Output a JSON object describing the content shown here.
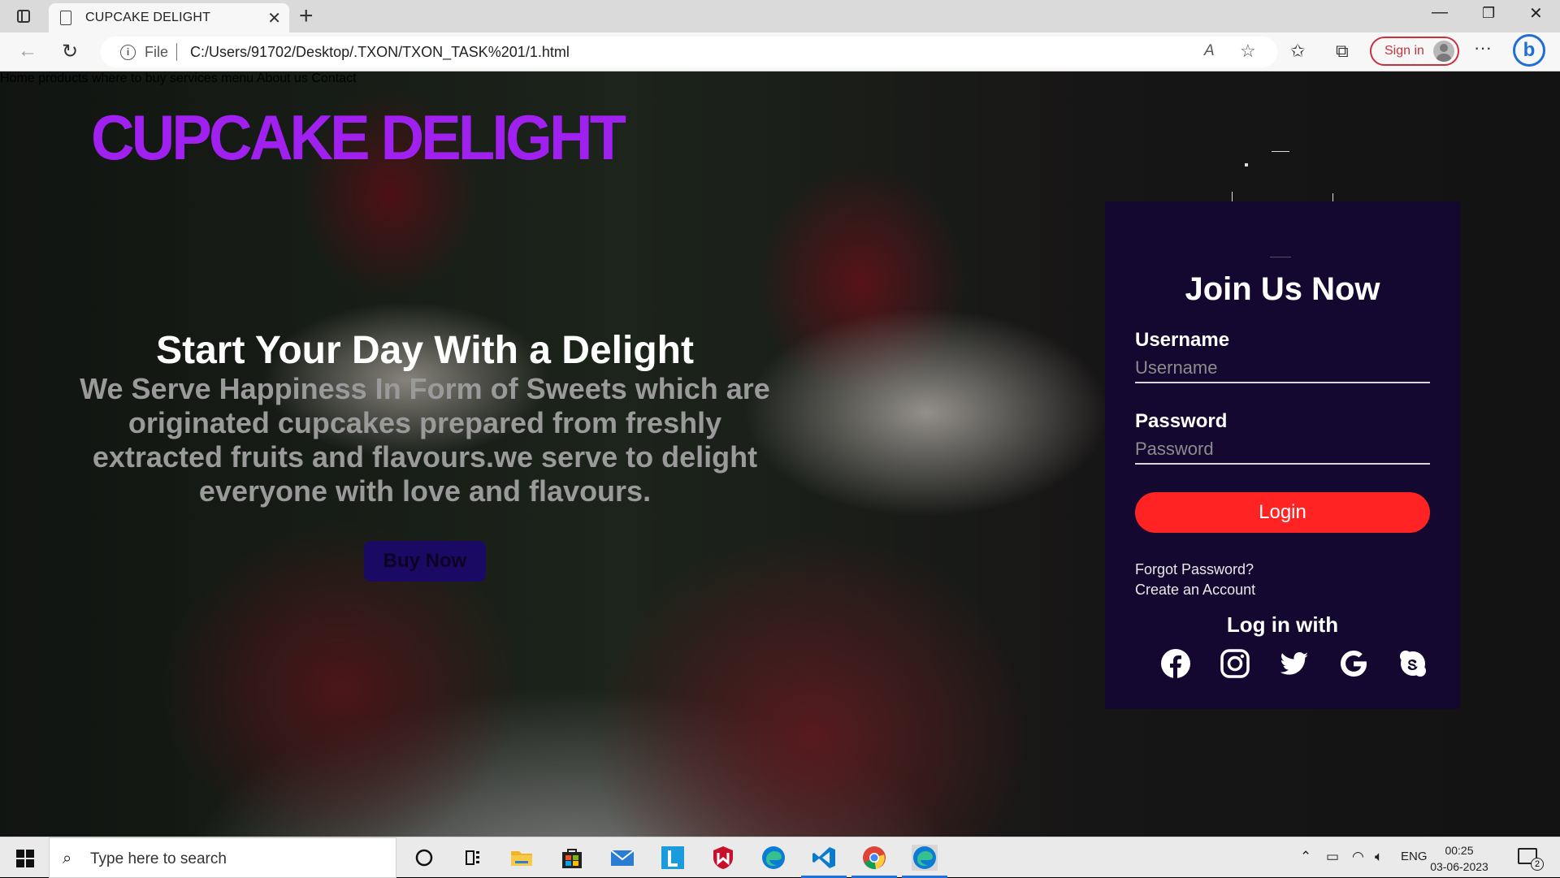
{
  "browser": {
    "tab_title": "CUPCAKE DELIGHT",
    "url_scheme_label": "File",
    "url": "C:/Users/91702/Desktop/.TXON/TXON_TASK%201/1.html",
    "signin_label": "Sign in"
  },
  "site": {
    "logo": "CUPCAKE DELIGHT",
    "nav": [
      "Home",
      "products",
      "where to buy",
      "services",
      "menu",
      "About us",
      "Contact"
    ]
  },
  "hero": {
    "title": "Start Your Day With a Delight",
    "text": "We Serve Happiness In Form of Sweets which are originated cupcakes prepared from freshly extracted fruits and flavours.we serve to delight everyone with love and flavours.",
    "button": "Buy Now"
  },
  "login": {
    "title": "Join Us Now",
    "username_label": "Username",
    "username_placeholder": "Username",
    "password_label": "Password",
    "password_placeholder": "Password",
    "login_button": "Login",
    "forgot": "Forgot Password?",
    "create": "Create an Account",
    "login_with": "Log in with",
    "social_icons": [
      "facebook-icon",
      "instagram-icon",
      "twitter-icon",
      "google-icon",
      "skype-icon"
    ]
  },
  "taskbar": {
    "search_placeholder": "Type here to search",
    "language": "ENG",
    "time": "00:25",
    "date": "03-06-2023",
    "notification_count": "2"
  },
  "colors": {
    "logo": "#a020f0",
    "login_panel": "#150830",
    "login_button": "#ff2323",
    "buy_button": "#1b0a63"
  }
}
